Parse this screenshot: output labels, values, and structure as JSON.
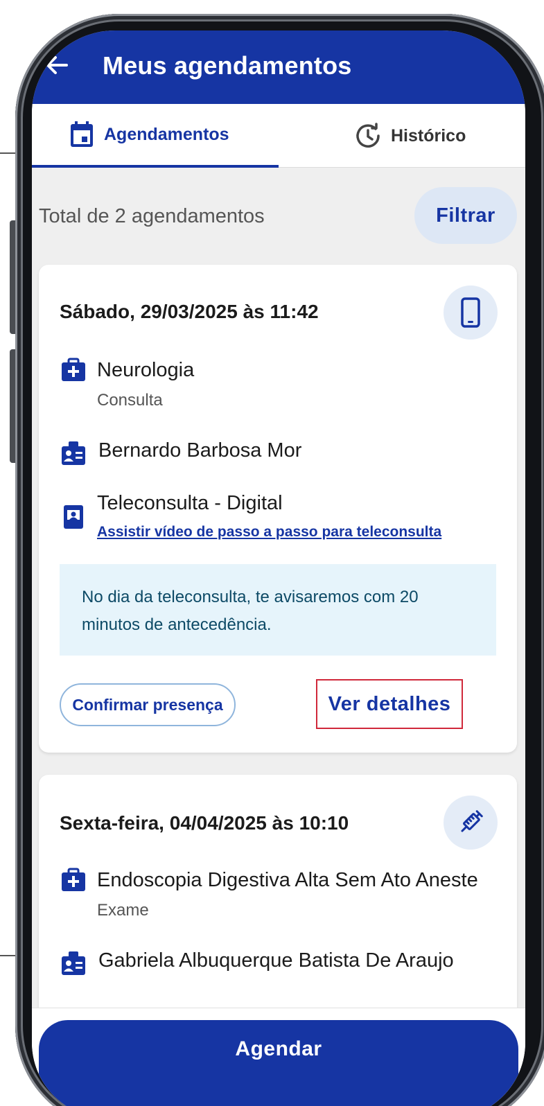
{
  "header": {
    "title": "Meus agendamentos"
  },
  "tabs": [
    {
      "label": "Agendamentos",
      "icon": "calendar-icon",
      "active": true
    },
    {
      "label": "Histórico",
      "icon": "history-icon",
      "active": false
    }
  ],
  "summary": {
    "total_text": "Total de 2 agendamentos",
    "filter_label": "Filtrar"
  },
  "appointments": [
    {
      "datetime": "Sábado, 29/03/2025 às 11:42",
      "type_icon": "smartphone-icon",
      "specialty": "Neurologia",
      "category": "Consulta",
      "professional": "Bernardo Barbosa Mor",
      "modality": "Teleconsulta - Digital",
      "video_link": "Assistir vídeo de passo a passo para teleconsulta",
      "notice": "No dia da teleconsulta, te avisaremos com 20 minutos de antecedência.",
      "confirm_label": "Confirmar presença",
      "details_label": "Ver detalhes"
    },
    {
      "datetime": "Sexta-feira, 04/04/2025 às 10:10",
      "type_icon": "syringe-icon",
      "specialty": "Endoscopia Digestiva Alta Sem Ato Aneste",
      "category": "Exame",
      "professional": "Gabriela Albuquerque Batista De Araujo"
    }
  ],
  "footer": {
    "schedule_label": "Agendar"
  },
  "colors": {
    "primary": "#1635a3",
    "badge_bg": "#e4ecf7",
    "notice_bg": "#e6f4fb",
    "highlight": "#d0283a"
  }
}
